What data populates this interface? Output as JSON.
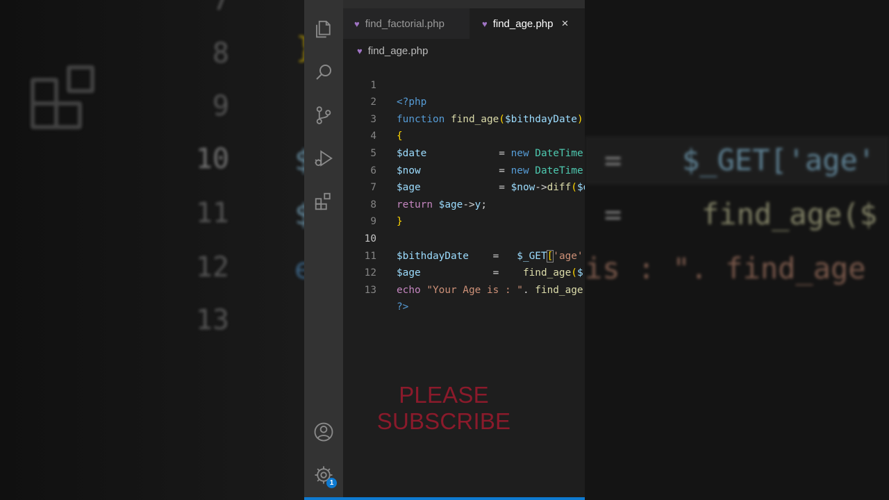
{
  "tabs": [
    {
      "label": "find_factorial.php",
      "icon": "php-elephant-icon"
    },
    {
      "label": "find_age.php",
      "icon": "php-elephant-icon",
      "active": true,
      "close": "×"
    }
  ],
  "breadcrumb": "find_age.php",
  "current_line": 10,
  "code_lines": [
    {
      "n": "1",
      "text": "<?php"
    },
    {
      "n": "2",
      "text": "function find_age($bithdayDate)"
    },
    {
      "n": "3",
      "text": "{"
    },
    {
      "n": "4",
      "text": "$date            = new DateTime("
    },
    {
      "n": "5",
      "text": "$now             = new DateTime("
    },
    {
      "n": "6",
      "text": "$age             = $now->diff($d"
    },
    {
      "n": "7",
      "text": "return $age->y;"
    },
    {
      "n": "8",
      "text": "}"
    },
    {
      "n": "9",
      "text": ""
    },
    {
      "n": "10",
      "text": "$bithdayDate    =   $_GET['age'"
    },
    {
      "n": "11",
      "text": "$age            =    find_age($"
    },
    {
      "n": "12",
      "text": "echo \"Your Age is : \". find_age"
    },
    {
      "n": "13",
      "text": "?>"
    }
  ],
  "overlay_text": "PLEASE SUBSCRIBE",
  "activity_icons": [
    "explorer-icon",
    "search-icon",
    "source-control-icon",
    "run-debug-icon",
    "extensions-icon",
    "account-icon",
    "settings-gear-icon"
  ],
  "settings_badge": "1",
  "background": {
    "left_line_numbers": [
      "7",
      "8",
      "9",
      "10",
      "11",
      "12",
      "13"
    ],
    "right_snippets": [
      "=",
      "$_GET['age'",
      "=",
      "find_age($",
      "is : \". find_age"
    ]
  },
  "colors": {
    "editor_bg": "#1e1e1e",
    "activity_bar": "#333333",
    "accent": "#0e7ad1",
    "subscribe": "#8b1a2b"
  }
}
